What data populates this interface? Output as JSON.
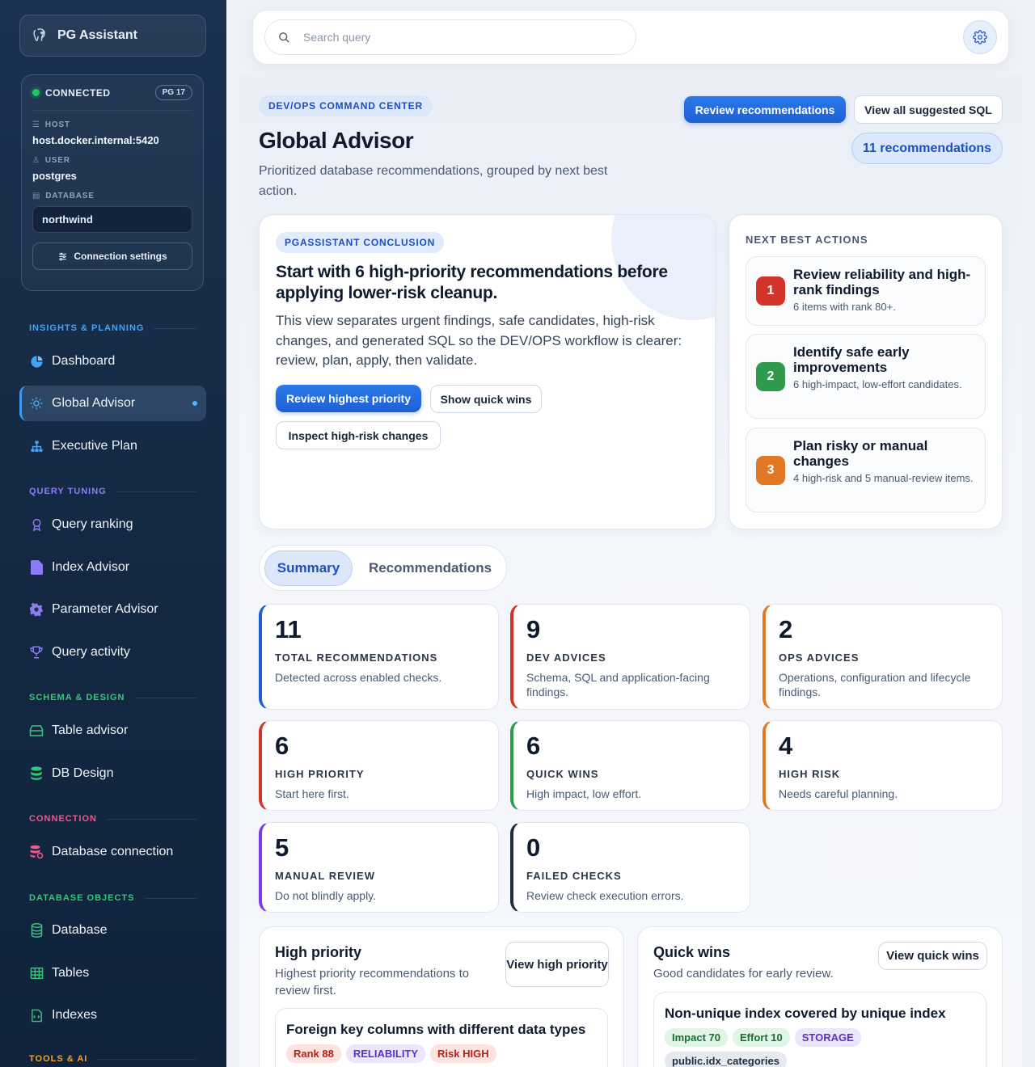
{
  "app": {
    "name": "PG Assistant"
  },
  "connection": {
    "status": "CONNECTED",
    "version": "PG 17",
    "host_label": "HOST",
    "host": "host.docker.internal:5420",
    "user_label": "USER",
    "user": "postgres",
    "database_label": "DATABASE",
    "database": "northwind",
    "settings_label": "Connection settings"
  },
  "sidebar": {
    "sections": [
      {
        "title": "INSIGHTS & PLANNING",
        "color": "#4aa3f0"
      },
      {
        "title": "QUERY TUNING",
        "color": "#8b7cf6"
      },
      {
        "title": "SCHEMA & DESIGN",
        "color": "#34c77b"
      },
      {
        "title": "CONNECTION",
        "color": "#ef5a8a"
      },
      {
        "title": "DATABASE OBJECTS",
        "color": "#34c77b"
      },
      {
        "title": "TOOLS & AI",
        "color": "#f0a23a"
      }
    ],
    "items": [
      {
        "label": "Dashboard",
        "icon": "pie-chart-icon"
      },
      {
        "label": "Global Advisor",
        "icon": "sun-icon",
        "active": true
      },
      {
        "label": "Executive Plan",
        "icon": "sitemap-icon"
      },
      {
        "label": "Query ranking",
        "icon": "award-icon"
      },
      {
        "label": "Index Advisor",
        "icon": "file-icon"
      },
      {
        "label": "Parameter Advisor",
        "icon": "cog-icon"
      },
      {
        "label": "Query activity",
        "icon": "trophy-icon"
      },
      {
        "label": "Table advisor",
        "icon": "table-icon"
      },
      {
        "label": "DB Design",
        "icon": "layers-icon"
      },
      {
        "label": "Database connection",
        "icon": "database-settings-icon"
      },
      {
        "label": "Database",
        "icon": "database-icon"
      },
      {
        "label": "Tables",
        "icon": "grid-icon"
      },
      {
        "label": "Indexes",
        "icon": "index-icon"
      }
    ]
  },
  "search": {
    "placeholder": "Search query"
  },
  "header": {
    "eyebrow": "DEV/OPS COMMAND CENTER",
    "title": "Global Advisor",
    "subtitle": "Prioritized database recommendations, grouped by next best action.",
    "review_button": "Review recommendations",
    "view_sql_button": "View all suggested SQL",
    "count_pill": "11 recommendations"
  },
  "conclusion": {
    "tag": "PGASSISTANT CONCLUSION",
    "title": "Start with 6 high-priority recommendations before applying lower-risk cleanup.",
    "body": "This view separates urgent findings, safe candidates, high-risk changes, and generated SQL so the DEV/OPS workflow is clearer: review, plan, apply, then validate.",
    "btn_high": "Review highest priority",
    "btn_quick": "Show quick wins",
    "btn_risk": "Inspect high-risk changes"
  },
  "next_actions": {
    "title": "NEXT BEST ACTIONS",
    "items": [
      {
        "num": "1",
        "title": "Review reliability and high-rank findings",
        "desc": "6 items with rank 80+.",
        "color": "#d2342a"
      },
      {
        "num": "2",
        "title": "Identify safe early improvements",
        "desc": "6 high-impact, low-effort candidates.",
        "color": "#2f9a4c"
      },
      {
        "num": "3",
        "title": "Plan risky or manual changes",
        "desc": "4 high-risk and 5 manual-review items.",
        "color": "#e07824"
      }
    ]
  },
  "tabs": [
    {
      "label": "Summary"
    },
    {
      "label": "Recommendations"
    }
  ],
  "stats": [
    {
      "num": "11",
      "label": "TOTAL RECOMMENDATIONS",
      "desc": "Detected across enabled checks.",
      "color": "#1e5fd6"
    },
    {
      "num": "9",
      "label": "DEV ADVICES",
      "desc": "Schema, SQL and application-facing findings.",
      "color": "#d2342a"
    },
    {
      "num": "2",
      "label": "OPS ADVICES",
      "desc": "Operations, configuration and lifecycle findings.",
      "color": "#e07824"
    },
    {
      "num": "6",
      "label": "HIGH PRIORITY",
      "desc": "Start here first.",
      "color": "#d2342a"
    },
    {
      "num": "6",
      "label": "QUICK WINS",
      "desc": "High impact, low effort.",
      "color": "#2f9a4c"
    },
    {
      "num": "4",
      "label": "HIGH RISK",
      "desc": "Needs careful planning.",
      "color": "#e07824"
    },
    {
      "num": "5",
      "label": "MANUAL REVIEW",
      "desc": "Do not blindly apply.",
      "color": "#7c3aed"
    },
    {
      "num": "0",
      "label": "FAILED CHECKS",
      "desc": "Review check execution errors.",
      "color": "#1f2d40"
    }
  ],
  "high_priority": {
    "title": "High priority",
    "subtitle": "Highest priority recommendations to review first.",
    "button": "View high priority",
    "card": {
      "title": "Foreign key columns with different data types",
      "chips": [
        {
          "text": "Rank 88",
          "bg": "#fde2e0",
          "fg": "#b42318"
        },
        {
          "text": "RELIABILITY",
          "bg": "#ece6fd",
          "fg": "#5b32c7"
        },
        {
          "text": "Risk HIGH",
          "bg": "#fde2e0",
          "fg": "#b42318"
        }
      ]
    }
  },
  "quick_wins": {
    "title": "Quick wins",
    "subtitle": "Good candidates for early review.",
    "button": "View quick wins",
    "card": {
      "title": "Non-unique index covered by unique index",
      "chips": [
        {
          "text": "Impact 70",
          "bg": "#dff5e6",
          "fg": "#1c6b36"
        },
        {
          "text": "Effort 10",
          "bg": "#dff5e6",
          "fg": "#1c6b36"
        },
        {
          "text": "STORAGE",
          "bg": "#ece6fd",
          "fg": "#5b32c7"
        },
        {
          "text": "public.idx_categories",
          "bg": "#e6eaf0",
          "fg": "#1f2d40"
        }
      ]
    }
  }
}
